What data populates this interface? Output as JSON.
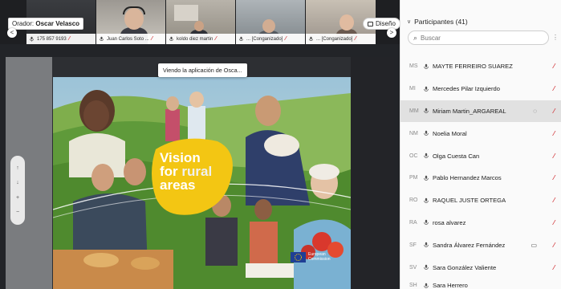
{
  "stage": {
    "speaker_prefix": "Orador:",
    "speaker_name": "Oscar Velasco",
    "layout_button": "Diseño",
    "nav_prev": "<",
    "nav_next": ">",
    "viewing_banner": "Viendo la aplicación de Osca...",
    "zoom_controls": [
      "↑",
      "↓",
      "+",
      "−"
    ]
  },
  "tiles": [
    {
      "name": "175 857 9193",
      "muted": true
    },
    {
      "name": "Juan Carlos Soto ...",
      "muted": true
    },
    {
      "name": "koldo diez martin",
      "muted": true
    },
    {
      "name": "... [Conganizado]",
      "muted": true
    },
    {
      "name": "... [Conganizado]",
      "muted": true
    }
  ],
  "slide": {
    "title_line1": "Vision",
    "title_line2_a": "for ",
    "title_line2_b": "rural",
    "title_line3": "areas",
    "footer_logo": "European Commission"
  },
  "panel": {
    "title": "Participantes (41)",
    "search_placeholder": "Buscar",
    "participants": [
      {
        "initials": "MS",
        "name": "MAYTE FERREIRO SUAREZ",
        "muted": true,
        "extra": ""
      },
      {
        "initials": "MI",
        "name": "Mercedes Pilar Izquierdo",
        "muted": true,
        "extra": ""
      },
      {
        "initials": "MM",
        "name": "Miriam Martin_ARGAREAL",
        "muted": true,
        "extra": "◌",
        "selected": true
      },
      {
        "initials": "NM",
        "name": "Noelia Moral",
        "muted": true,
        "extra": ""
      },
      {
        "initials": "OC",
        "name": "Olga Cuesta Can",
        "muted": true,
        "extra": ""
      },
      {
        "initials": "PM",
        "name": "Pablo Hernandez Marcos",
        "muted": true,
        "extra": ""
      },
      {
        "initials": "RO",
        "name": "RAQUEL JUSTE ORTEGA",
        "muted": true,
        "extra": ""
      },
      {
        "initials": "RA",
        "name": "rosa alvarez",
        "muted": true,
        "extra": ""
      },
      {
        "initials": "SF",
        "name": "Sandra Álvarez Fernández",
        "muted": true,
        "extra": "▭"
      },
      {
        "initials": "SV",
        "name": "Sara González Valiente",
        "muted": true,
        "extra": ""
      },
      {
        "initials": "SH",
        "name": "Sara Herrero",
        "muted": false,
        "extra": ""
      }
    ]
  },
  "colors": {
    "accent": "#f3c613",
    "mute": "#d13438",
    "panel": "#fafafa"
  }
}
